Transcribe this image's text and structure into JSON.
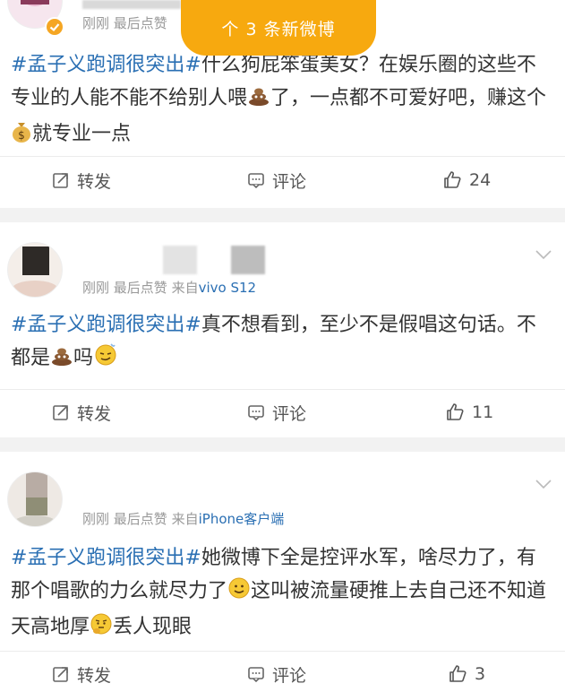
{
  "new_banner": "个 3 条新微博",
  "posts": [
    {
      "meta_time": "刚刚",
      "meta_likes": "最后点赞",
      "hashtag": "#孟子义跑调很突出#",
      "text_parts": [
        "什么狗屁笨蛋美女？在娱乐圈的这些不专业的人能不能不给别人喂",
        "了，一点都不可爱好吧，赚这个",
        "就专业一点"
      ],
      "repost": "转发",
      "comment": "评论",
      "likes": "24"
    },
    {
      "meta_time": "刚刚",
      "meta_likes": "最后点赞",
      "meta_from": "来自",
      "meta_device": "vivo S12",
      "hashtag": "#孟子义跑调很突出#",
      "text_parts": [
        "真不想看到，至少不是假唱这句话。不都是",
        "吗"
      ],
      "repost": "转发",
      "comment": "评论",
      "likes": "11"
    },
    {
      "meta_time": "刚刚",
      "meta_likes": "最后点赞",
      "meta_from": "来自",
      "meta_device": "iPhone客户端",
      "hashtag": "#孟子义跑调很突出#",
      "text_parts": [
        "她微博下全是控评水军，啥尽力了，有那个唱歌的力么就尽力了",
        "这叫被流量硬推上去自己还不知道天高地厚",
        "丢人现眼"
      ],
      "repost": "转发",
      "comment": "评论",
      "likes": "3"
    }
  ]
}
